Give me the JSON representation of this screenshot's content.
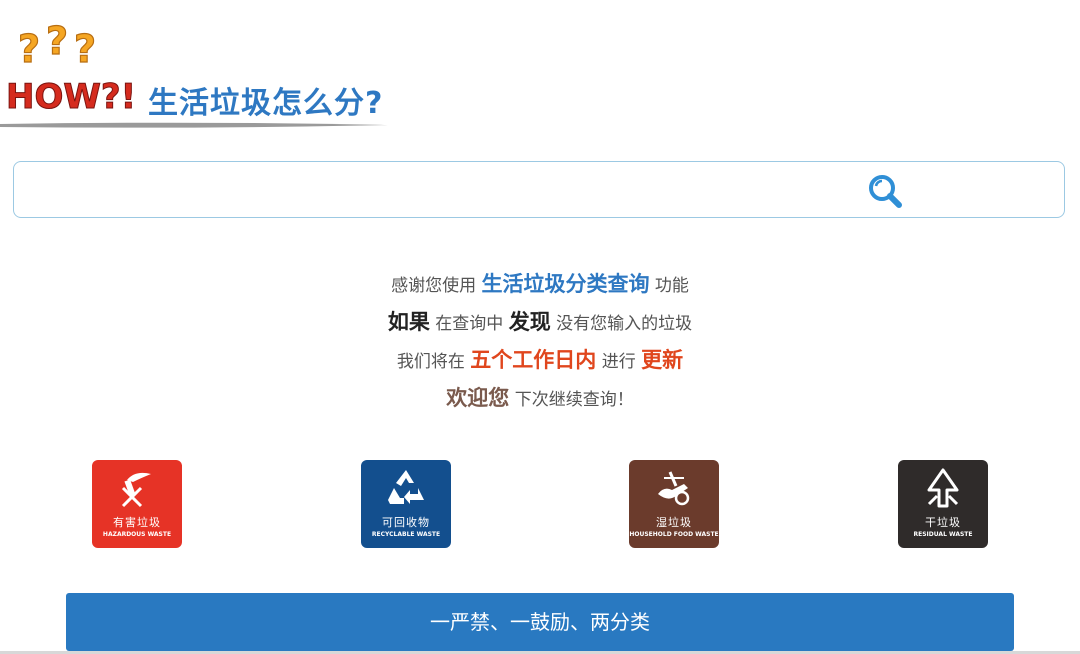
{
  "header": {
    "logo_text": "HOW?!",
    "title": "生活垃圾怎么分?"
  },
  "search": {
    "value": "",
    "placeholder": ""
  },
  "info": {
    "line1": {
      "a": "感谢您使用 ",
      "b": "生活垃圾分类查询",
      "c": " 功能"
    },
    "line2": {
      "a": "如果",
      "b": " 在查询中 ",
      "c": "发现",
      "d": " 没有您输入的垃圾"
    },
    "line3": {
      "a": "我们将在 ",
      "b": "五个工作日内",
      "c": " 进行 ",
      "d": "更新"
    },
    "line4": {
      "a": "欢迎您",
      "b": " 下次继续查询！"
    }
  },
  "bins": [
    {
      "zh": "有害垃圾",
      "en": "HAZARDOUS WASTE",
      "color": "#e63326",
      "icon": "hazardous-battery-icon"
    },
    {
      "zh": "可回收物",
      "en": "RECYCLABLE WASTE",
      "color": "#134f8e",
      "icon": "recycle-icon"
    },
    {
      "zh": "湿垃圾",
      "en": "HOUSEHOLD FOOD WASTE",
      "color": "#6b3b2c",
      "icon": "food-waste-icon"
    },
    {
      "zh": "干垃圾",
      "en": "RESIDUAL WASTE",
      "color": "#2f2b2a",
      "icon": "residual-waste-icon"
    }
  ],
  "footer_button": {
    "label": "一严禁、一鼓励、两分类"
  },
  "colors": {
    "accent_blue": "#2e78c2",
    "button_blue": "#2979c1",
    "highlight_red": "#e0461d",
    "highlight_brown": "#7a5a4d"
  }
}
